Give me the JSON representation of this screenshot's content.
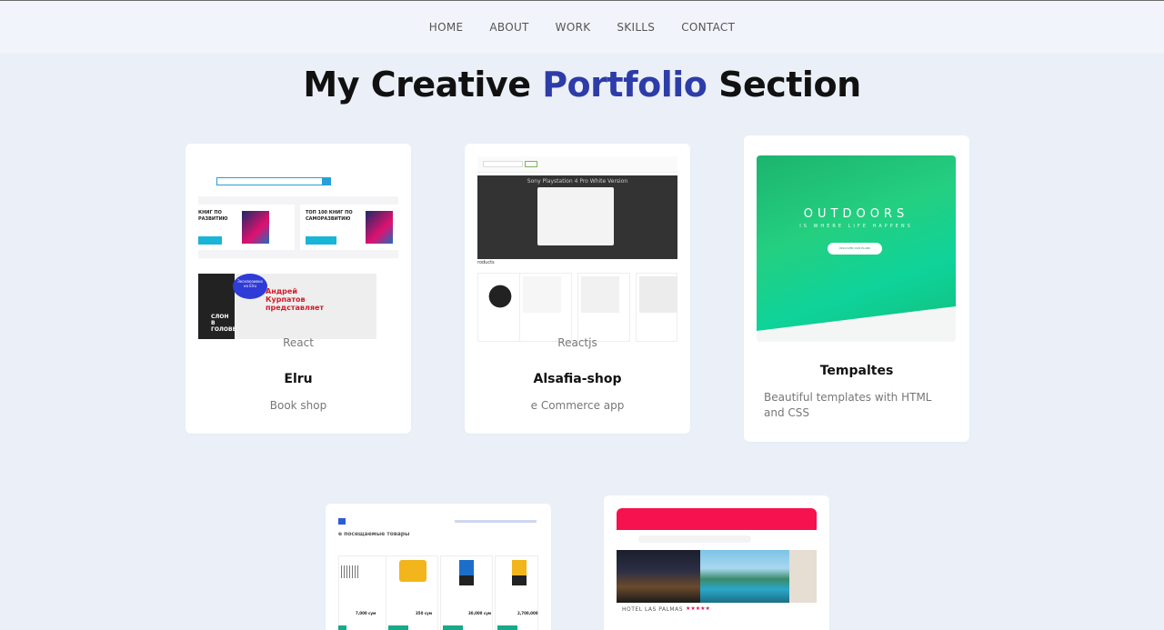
{
  "nav": {
    "items": [
      "HOME",
      "ABOUT",
      "WORK",
      "SKILLS",
      "CONTACT"
    ]
  },
  "heading": {
    "part1": "My Creative ",
    "accent": "Portfolio",
    "part2": " Section"
  },
  "colors": {
    "background": "#ebf0f8",
    "accent": "#2d3ca8",
    "card": "#ffffff"
  },
  "projects": [
    {
      "tech": "React",
      "name": "Elru",
      "description": "Book shop"
    },
    {
      "tech": "Reactjs",
      "name": "Alsafia-shop",
      "description": "e Commerce app"
    },
    {
      "tech": "",
      "name": "Tempaltes",
      "description": "Beautiful templates with HTML and CSS"
    }
  ],
  "thumbs": {
    "elru": {
      "promo_left": "КНИГ ПО РАЗВИТИЮ",
      "promo_right": "ТОП 100 КНИГ ПО САМОРАЗВИТИЮ",
      "banner_badge": "Эксклюзивно на Elru",
      "banner_title": "Андрей Курпатов представляет",
      "book_title": "СЛОН В ГОЛОВЕ"
    },
    "alsafia": {
      "hero_title": "Sony Playstation 4 Pro White Version",
      "section_label": "roducts"
    },
    "templates": {
      "hero_title": "OUTDOORS",
      "hero_sub": "IS WHERE LIFE HAPPENS",
      "hero_button": "DISCOVER OUR PLANS"
    },
    "tools": {
      "section_label": "е посещаемые товары",
      "prices": [
        "7,000 сум",
        "350 сум",
        "30,000 сум",
        "2,700,000"
      ]
    },
    "hotel": {
      "hotel_name": "HOTEL LAS PALMAS",
      "stars": "★★★★★"
    }
  }
}
